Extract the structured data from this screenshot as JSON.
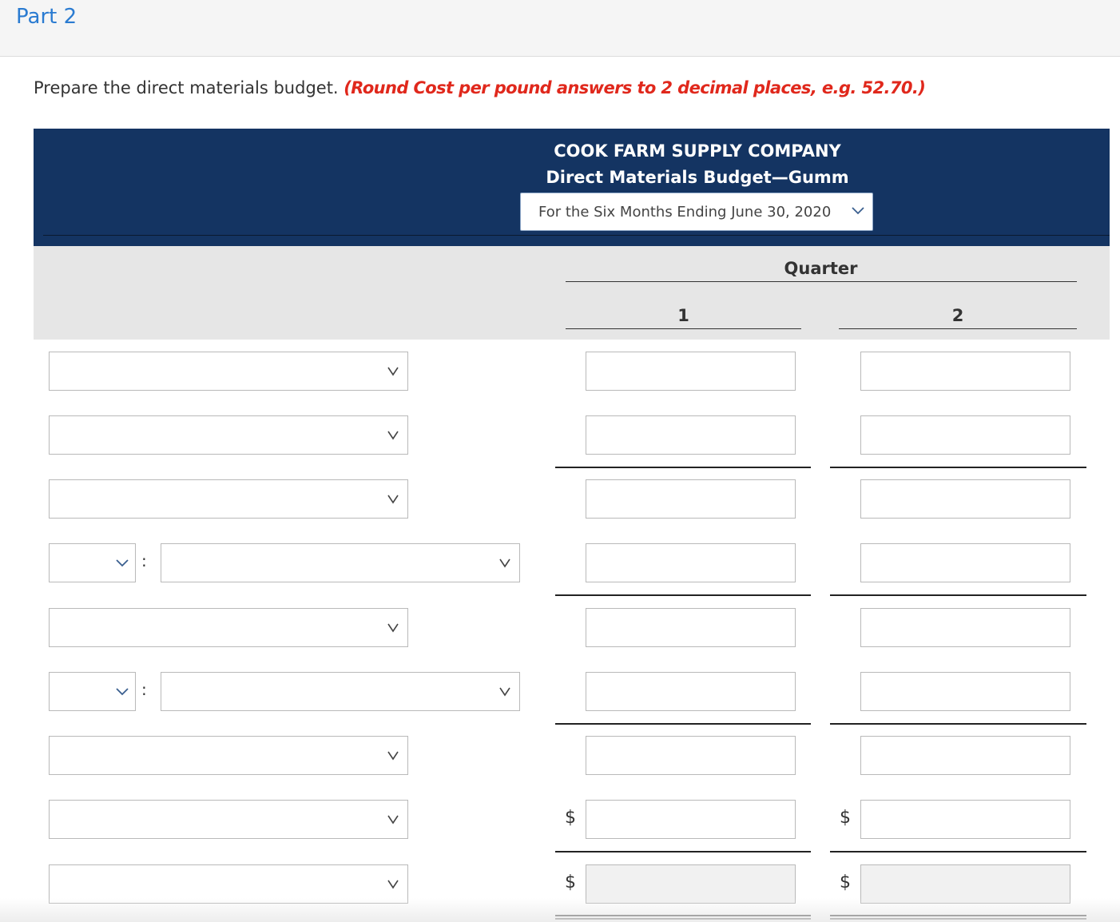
{
  "part": {
    "title": "Part 2"
  },
  "instructions": {
    "text": "Prepare the direct materials budget.",
    "note": "(Round Cost per pound answers to 2 decimal places, e.g. 52.70.)"
  },
  "header": {
    "company": "COOK FARM SUPPLY COMPANY",
    "title": "Direct Materials Budget—Gumm",
    "period_selected": "For the Six Months Ending June 30, 2020"
  },
  "columns": {
    "group_label": "Quarter",
    "col1": "1",
    "col2": "2"
  },
  "rows": {
    "colon": ":",
    "currency_symbol": "$"
  },
  "colors": {
    "header_band": "#143462",
    "part_title": "#2a7bd1",
    "note": "#e0281c",
    "column_header_bg": "#e6e6e6"
  }
}
